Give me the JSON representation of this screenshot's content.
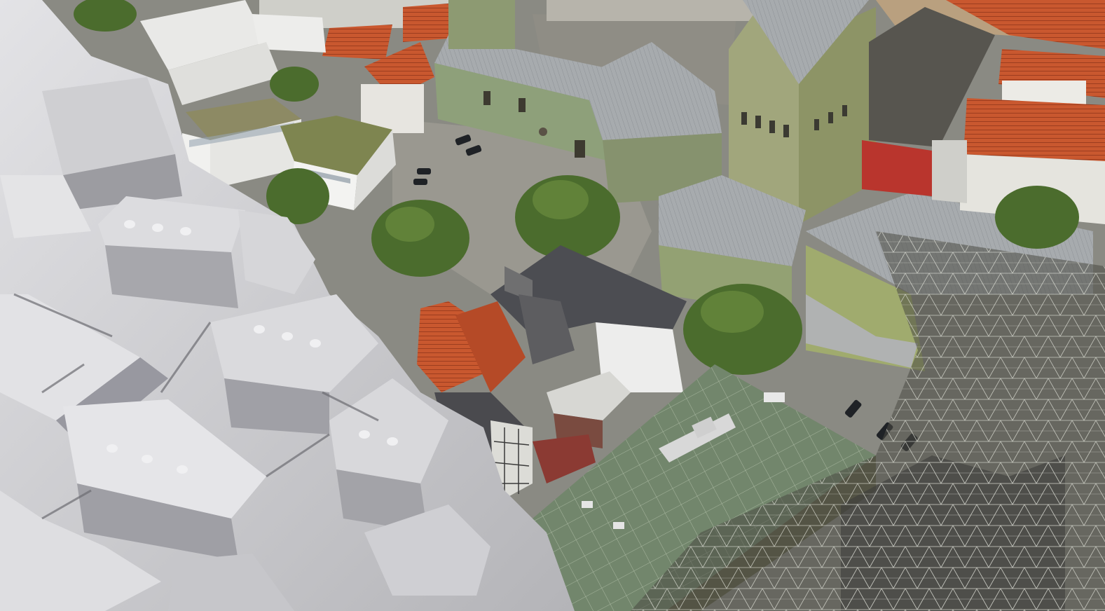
{
  "scene": {
    "subject": "aerial-3d-city-reconstruction",
    "regions": [
      "gray-untextured-mesh",
      "photo-textured-mesh",
      "wireframe-triangulated-mesh"
    ]
  },
  "colors": {
    "mesh_gray": "#d2d2d4",
    "mesh_shadow": "#8d8d93",
    "ground": "#8b8b84",
    "green_roof": "#71846b",
    "church_wall": "#94a074",
    "church_roof": "#a4a8ab",
    "tile_red": "#c8572f",
    "tree": "#4a6d2c",
    "wire": "#e4e6de"
  }
}
